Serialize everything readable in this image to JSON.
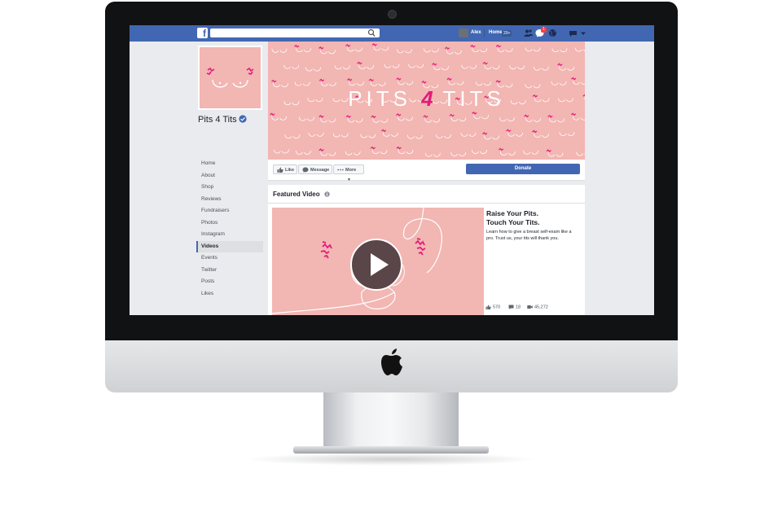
{
  "topbar": {
    "search_placeholder": "",
    "user_name": "Alex",
    "home_label": "Home",
    "home_badge": "20+",
    "notification_count": "1"
  },
  "profile": {
    "page_name": "Pits 4 Tits"
  },
  "sidebar": {
    "items": [
      {
        "label": "Home"
      },
      {
        "label": "About"
      },
      {
        "label": "Shop"
      },
      {
        "label": "Reviews"
      },
      {
        "label": "Fundraisers"
      },
      {
        "label": "Photos"
      },
      {
        "label": "Instagram"
      },
      {
        "label": "Videos"
      },
      {
        "label": "Events"
      },
      {
        "label": "Twitter"
      },
      {
        "label": "Posts"
      },
      {
        "label": "Likes"
      }
    ],
    "active_index": 7
  },
  "cover": {
    "title_left": "PITS",
    "title_mid": "4",
    "title_right": "TITS"
  },
  "actions": {
    "like_label": "Like",
    "message_label": "Message",
    "more_label": "More",
    "donate_label": "Donate"
  },
  "featured": {
    "header": "Featured Video",
    "title_line1": "Raise Your Pits.",
    "title_line2": "Touch Your Tits.",
    "description": "Learn how to give a breast self-exam like a pro. Trust us, your tits will thank you.",
    "likes": "570",
    "comments": "18",
    "views": "45,272"
  },
  "colors": {
    "facebook_blue": "#4267b2",
    "cover_pink": "#f2b6b3",
    "accent_magenta": "#e21b7a"
  }
}
